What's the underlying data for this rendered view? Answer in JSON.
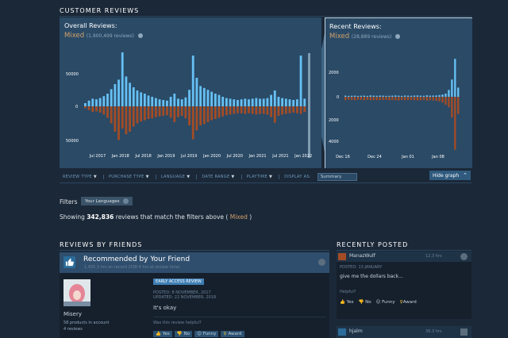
{
  "section_title": "CUSTOMER REVIEWS",
  "overall": {
    "title": "Overall Reviews:",
    "rating": "Mixed",
    "count": "(1,900,499 reviews)",
    "y_labels": [
      "50000",
      "0",
      "50000"
    ],
    "x_labels": [
      "Jul 2017",
      "Jan 2018",
      "Jul 2018",
      "Jan 2019",
      "Jul 2019",
      "Jan 2020",
      "Jul 2020",
      "Jan 2021",
      "Jul 2021",
      "Jan 2022"
    ]
  },
  "recent": {
    "title": "Recent Reviews:",
    "rating": "Mixed",
    "count": "(28,889 reviews)",
    "y_labels": [
      "2000",
      "0",
      "2000",
      "4000"
    ],
    "x_labels": [
      "Dec 16",
      "Dec 24",
      "Jan 01",
      "Jan 08"
    ]
  },
  "chart_data": [
    {
      "type": "bar",
      "title": "Overall Reviews:",
      "x_ticks": [
        "Jul 2017",
        "Jan 2018",
        "Jul 2018",
        "Jan 2019",
        "Jul 2019",
        "Jan 2020",
        "Jul 2020",
        "Jan 2021",
        "Jul 2021",
        "Jan 2022"
      ],
      "ylim": [
        -55000,
        90000
      ],
      "y_ticks": [
        50000,
        0,
        -50000
      ],
      "series": [
        {
          "name": "positive",
          "color": "#66c0f4",
          "values": [
            5000,
            9000,
            12000,
            11000,
            13000,
            16000,
            20000,
            27000,
            35000,
            42000,
            85000,
            47000,
            37000,
            30000,
            25000,
            22000,
            20000,
            17000,
            15000,
            13000,
            11000,
            10000,
            9000,
            15000,
            20000,
            12000,
            11000,
            14000,
            26000,
            80000,
            45000,
            32000,
            29000,
            26000,
            23000,
            20000,
            18000,
            15000,
            13000,
            12000,
            11000,
            10000,
            11000,
            12000,
            11000,
            12000,
            13000,
            12000,
            12000,
            13000,
            18000,
            25000,
            15000,
            13000,
            12000,
            11000,
            10000,
            11000,
            80000,
            12000
          ]
        },
        {
          "name": "negative",
          "color": "#a34c25",
          "values": [
            3000,
            6000,
            9000,
            8000,
            10000,
            13000,
            18000,
            27000,
            40000,
            53000,
            35000,
            44000,
            40000,
            32000,
            27000,
            24000,
            22000,
            20000,
            19000,
            17000,
            16000,
            15000,
            14000,
            18000,
            25000,
            17000,
            15000,
            19000,
            30000,
            52000,
            38000,
            30000,
            28000,
            25000,
            22000,
            20000,
            18000,
            16000,
            14000,
            13000,
            12000,
            11000,
            11000,
            12000,
            11000,
            12000,
            13000,
            12000,
            12000,
            13000,
            17000,
            26000,
            15000,
            13000,
            12000,
            11000,
            10000,
            11000,
            12000,
            9000
          ]
        }
      ]
    },
    {
      "type": "bar",
      "title": "Recent Reviews:",
      "x_ticks": [
        "Dec 16",
        "Dec 24",
        "Jan 01",
        "Jan 08"
      ],
      "ylim": [
        -5000,
        4000
      ],
      "y_ticks": [
        2000,
        0,
        -2000,
        -4000
      ],
      "series": [
        {
          "name": "positive",
          "color": "#66c0f4",
          "values": [
            100,
            80,
            90,
            100,
            80,
            90,
            100,
            80,
            120,
            100,
            90,
            110,
            100,
            80,
            90,
            100,
            120,
            100,
            80,
            110,
            100,
            90,
            110,
            120,
            100,
            90,
            130,
            100,
            110,
            120,
            150,
            200,
            280,
            600,
            1500,
            3300,
            800
          ]
        },
        {
          "name": "negative",
          "color": "#a34c25",
          "values": [
            300,
            250,
            280,
            300,
            250,
            270,
            300,
            260,
            300,
            280,
            300,
            290,
            280,
            260,
            300,
            280,
            300,
            320,
            280,
            300,
            280,
            270,
            300,
            320,
            300,
            280,
            330,
            300,
            320,
            350,
            400,
            500,
            700,
            900,
            1800,
            4600,
            1500
          ]
        }
      ]
    }
  ],
  "hide_graph": "Hide graph",
  "filters": {
    "review_type": "REVIEW TYPE",
    "purchase_type": "PURCHASE TYPE",
    "language": "LANGUAGE",
    "date_range": "DATE RANGE",
    "playtime": "PLAYTIME",
    "display_as": "DISPLAY AS:",
    "display_value": "Summary"
  },
  "filters_label": "Filters",
  "filter_tag": "Your Languages",
  "showing": {
    "prefix": "Showing ",
    "count": "342,836",
    "middle": " reviews that match the filters above ( ",
    "rating": "Mixed",
    "suffix": " )"
  },
  "friends": {
    "title": "REVIEWS BY FRIENDS",
    "card": {
      "heading": "Recommended by Your Friend",
      "hours": "1,455.3 hrs on record (338.4 hrs at review time)",
      "badge": "EARLY ACCESS REVIEW",
      "posted": "POSTED: 8 NOVEMBER, 2017",
      "updated": "UPDATED: 22 NOVEMBER, 2018",
      "text": "It's okay",
      "helpful_q": "Was this review helpful?",
      "yes": "Yes",
      "no": "No",
      "funny": "Funny",
      "award": "Award",
      "user": "Misery",
      "products": "58 products in account",
      "reviews": "4 reviews"
    }
  },
  "recent_posted": {
    "title": "RECENTLY POSTED",
    "item1": {
      "user": "ManazWulf",
      "hrs": "12.3 hrs",
      "posted": "POSTED: 13 JANUARY",
      "text": "give me the dollars back...",
      "helpful": "Helpful?",
      "yes": "Yes",
      "no": "No",
      "funny": "Funny",
      "award": "Award"
    },
    "item2": {
      "user": "hjalm",
      "hrs": "39.3 hrs"
    }
  }
}
